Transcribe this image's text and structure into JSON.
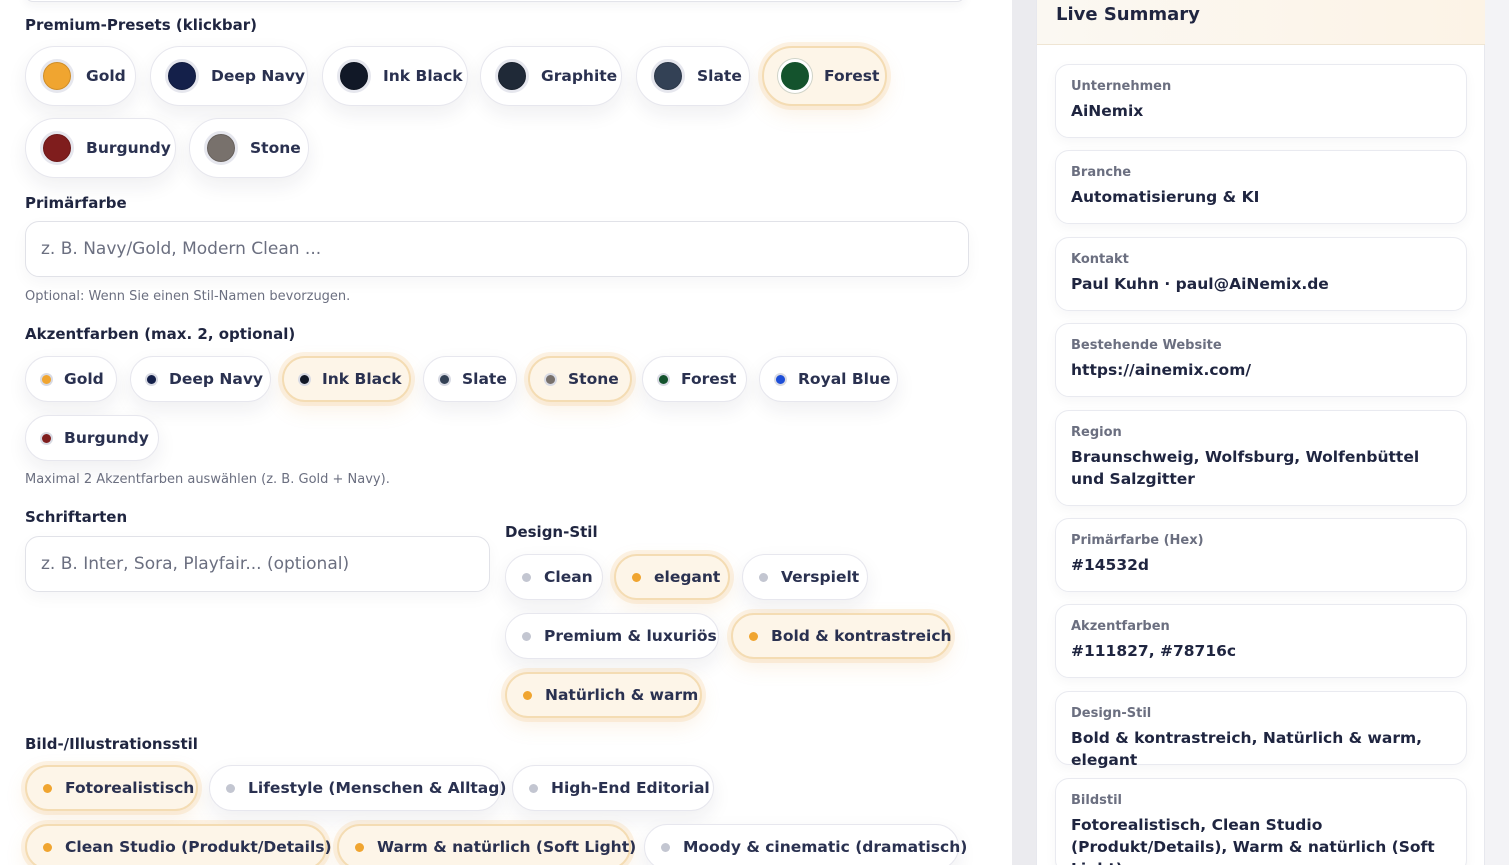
{
  "presets": {
    "label": "Premium-Presets (klickbar)",
    "items": [
      {
        "name": "Gold",
        "color": "#f0a530"
      },
      {
        "name": "Deep Navy",
        "color": "#14204a"
      },
      {
        "name": "Ink Black",
        "color": "#111827"
      },
      {
        "name": "Graphite",
        "color": "#1f2937"
      },
      {
        "name": "Slate",
        "color": "#334155"
      },
      {
        "name": "Forest",
        "color": "#14532d",
        "selected": true
      },
      {
        "name": "Burgundy",
        "color": "#7f1d1d"
      },
      {
        "name": "Stone",
        "color": "#78716c"
      }
    ]
  },
  "primary": {
    "label": "Primärfarbe",
    "placeholder": "z. B. Navy/Gold, Modern Clean ...",
    "hint": "Optional: Wenn Sie einen Stil-Namen bevorzugen."
  },
  "accents": {
    "label": "Akzentfarben (max. 2, optional)",
    "items": [
      {
        "name": "Gold",
        "color": "#f0a530"
      },
      {
        "name": "Deep Navy",
        "color": "#14204a"
      },
      {
        "name": "Ink Black",
        "color": "#111827",
        "selected": true
      },
      {
        "name": "Slate",
        "color": "#334155"
      },
      {
        "name": "Stone",
        "color": "#78716c",
        "selected": true
      },
      {
        "name": "Forest",
        "color": "#14532d"
      },
      {
        "name": "Royal Blue",
        "color": "#1d4ed8"
      },
      {
        "name": "Burgundy",
        "color": "#7f1d1d"
      }
    ],
    "hint": "Maximal 2 Akzentfarben auswählen (z. B. Gold + Navy)."
  },
  "fonts": {
    "label": "Schriftarten",
    "placeholder": "z. B. Inter, Sora, Playfair... (optional)"
  },
  "design": {
    "label": "Design-Stil",
    "items": [
      {
        "name": "Clean",
        "selected": false
      },
      {
        "name": "elegant",
        "selected": true
      },
      {
        "name": "Verspielt",
        "selected": false
      },
      {
        "name": "Premium & luxuriös",
        "selected": false
      },
      {
        "name": "Bold & kontrastreich",
        "selected": true
      },
      {
        "name": "Natürlich & warm",
        "selected": true
      }
    ]
  },
  "imagery": {
    "label": "Bild-/Illustrationsstil",
    "items": [
      {
        "name": "Fotorealistisch",
        "selected": true
      },
      {
        "name": "Lifestyle (Menschen & Alltag)",
        "selected": false
      },
      {
        "name": "High-End Editorial",
        "selected": false
      },
      {
        "name": "Clean Studio (Produkt/Details)",
        "selected": true
      },
      {
        "name": "Warm & natürlich (Soft Light)",
        "selected": true
      },
      {
        "name": "Moody & cinematic (dramatisch)",
        "selected": false
      }
    ]
  },
  "colors": {
    "selected_dot": "#f0a530",
    "unselected_dot": "#c3c6d1",
    "selected_bg": "#fdf5e8"
  },
  "summary": {
    "title": "Live Summary",
    "rows": [
      {
        "key": "Unternehmen",
        "value": "AiNemix"
      },
      {
        "key": "Branche",
        "value": "Automatisierung & KI"
      },
      {
        "key": "Kontakt",
        "value": "Paul Kuhn · paul@AiNemix.de"
      },
      {
        "key": "Bestehende Website",
        "value": "https://ainemix.com/"
      },
      {
        "key": "Region",
        "value": "Braunschweig, Wolfsburg, Wolfenbüttel und Salzgitter"
      },
      {
        "key": "Primärfarbe (Hex)",
        "value": "#14532d"
      },
      {
        "key": "Akzentfarben",
        "value": "#111827, #78716c"
      },
      {
        "key": "Design-Stil",
        "value": "Bold & kontrastreich, Natürlich & warm, elegant"
      },
      {
        "key": "Bildstil",
        "value": "Fotorealistisch, Clean Studio (Produkt/Details), Warm & natürlich (Soft Light)"
      }
    ]
  }
}
